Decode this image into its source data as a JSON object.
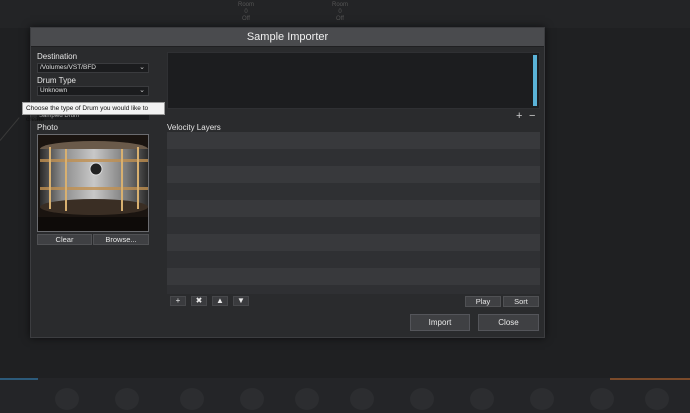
{
  "dialog": {
    "title": "Sample Importer",
    "destination_label": "Destination",
    "destination_value": "/Volumes/VST/BFD",
    "drum_type_label": "Drum Type",
    "drum_type_value": "Unknown",
    "tooltip": "Choose the type of Drum you would like to create",
    "hidden_field_value": "Sampled Drum",
    "photo_label": "Photo",
    "clear_label": "Clear",
    "browse_label": "Browse...",
    "velocity_label": "Velocity Layers",
    "add_remove": {
      "add": "+",
      "remove": "−"
    },
    "tools": {
      "add": "+",
      "delete": "✖",
      "up": "▲",
      "down": "▼"
    },
    "play_label": "Play",
    "sort_label": "Sort",
    "import_label": "Import",
    "close_label": "Close"
  },
  "background": {
    "top_ticks": [
      "Room\n0\nOff",
      "Room\n0\nOff"
    ]
  },
  "colors": {
    "accent": "#5ab3d8",
    "bg": "#1f2022",
    "dialog_bg": "#2a2b2d",
    "title_bar": "#4a4b4e"
  }
}
